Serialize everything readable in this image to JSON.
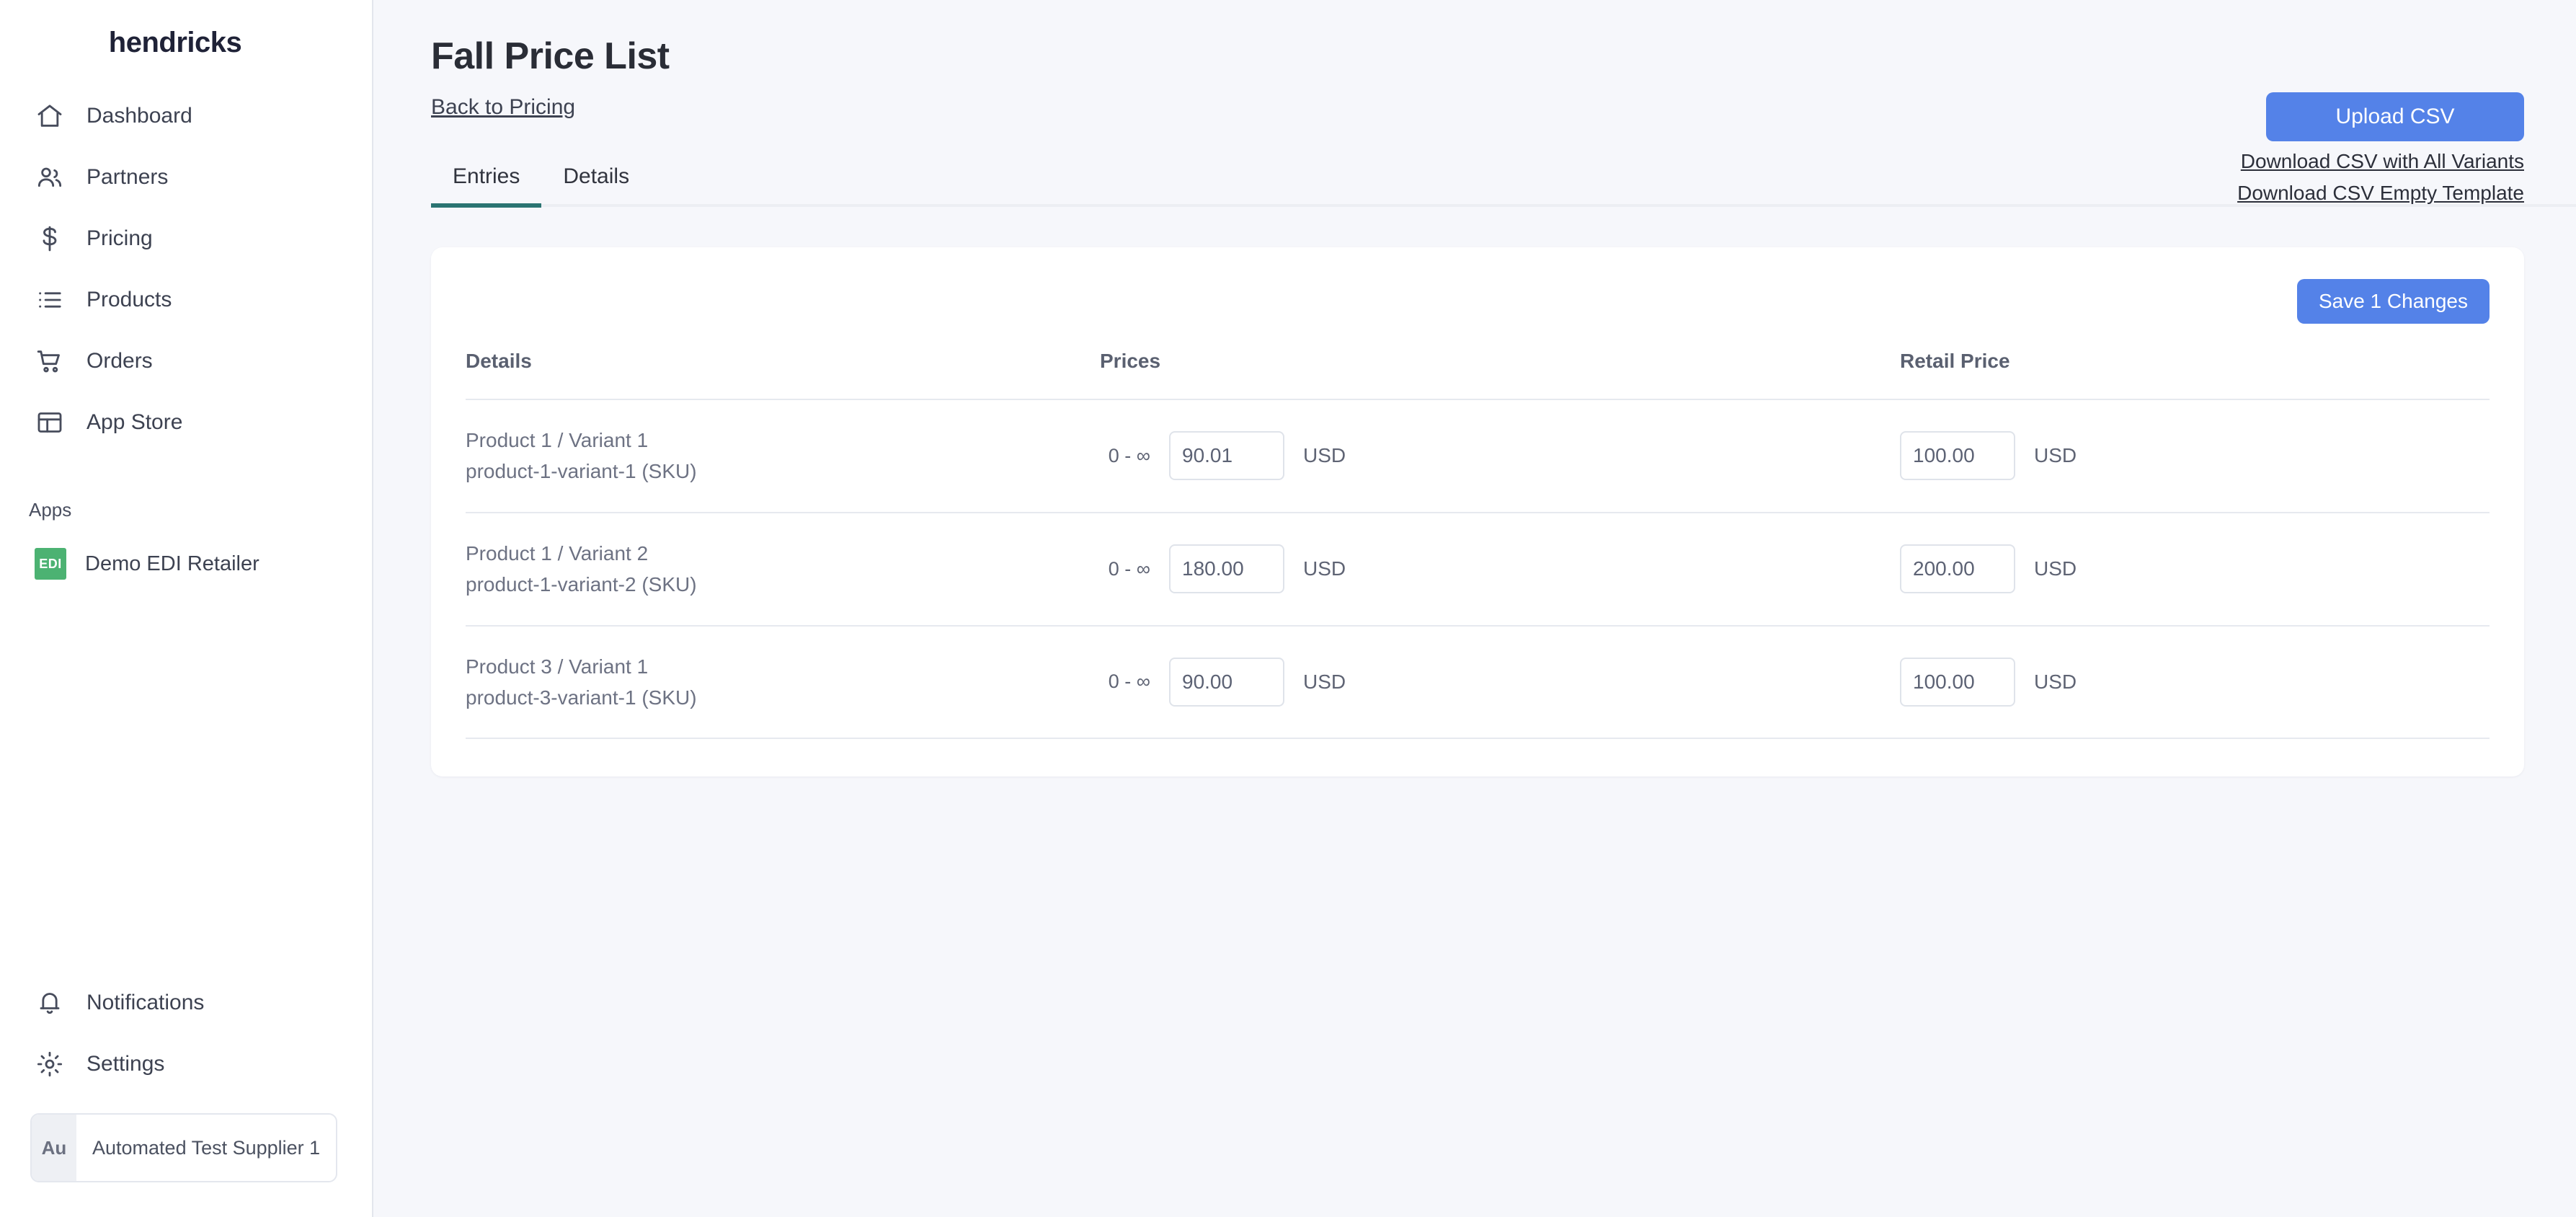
{
  "sidebar": {
    "brand": "hendricks",
    "nav_items": [
      {
        "label": "Dashboard",
        "icon": "home-icon"
      },
      {
        "label": "Partners",
        "icon": "users-icon"
      },
      {
        "label": "Pricing",
        "icon": "dollar-icon"
      },
      {
        "label": "Products",
        "icon": "list-icon"
      },
      {
        "label": "Orders",
        "icon": "cart-icon"
      },
      {
        "label": "App Store",
        "icon": "layout-icon"
      }
    ],
    "apps_section_label": "Apps",
    "apps": [
      {
        "badge": "EDI",
        "label": "Demo EDI Retailer",
        "badge_color": "#4cb272"
      }
    ],
    "bottom_items": [
      {
        "label": "Notifications",
        "icon": "bell-icon"
      },
      {
        "label": "Settings",
        "icon": "gear-icon"
      }
    ],
    "user": {
      "initials": "Au",
      "name": "Automated Test Supplier 1"
    }
  },
  "header": {
    "title": "Fall Price List",
    "back_link": "Back to Pricing",
    "upload_button": "Upload CSV",
    "download_all_variants": "Download CSV with All Variants",
    "download_empty_template": "Download CSV Empty Template"
  },
  "tabs": [
    {
      "label": "Entries",
      "active": true
    },
    {
      "label": "Details",
      "active": false
    }
  ],
  "entries_card": {
    "save_button": "Save 1 Changes",
    "columns": [
      "Details",
      "Prices",
      "Retail Price"
    ],
    "rows": [
      {
        "product": "Product 1 / Variant 1",
        "sku": "product-1-variant-1 (SKU)",
        "range": "0 - ∞",
        "price": "90.01",
        "price_currency": "USD",
        "retail_price": "100.00",
        "retail_currency": "USD"
      },
      {
        "product": "Product 1 / Variant 2",
        "sku": "product-1-variant-2 (SKU)",
        "range": "0 - ∞",
        "price": "180.00",
        "price_currency": "USD",
        "retail_price": "200.00",
        "retail_currency": "USD"
      },
      {
        "product": "Product 3 / Variant 1",
        "sku": "product-3-variant-1 (SKU)",
        "range": "0 - ∞",
        "price": "90.00",
        "price_currency": "USD",
        "retail_price": "100.00",
        "retail_currency": "USD"
      }
    ]
  },
  "colors": {
    "accent_blue": "#5482e8",
    "tab_active": "#2b7472",
    "app_bg": "#f6f7fb",
    "badge_green": "#4cb272"
  }
}
